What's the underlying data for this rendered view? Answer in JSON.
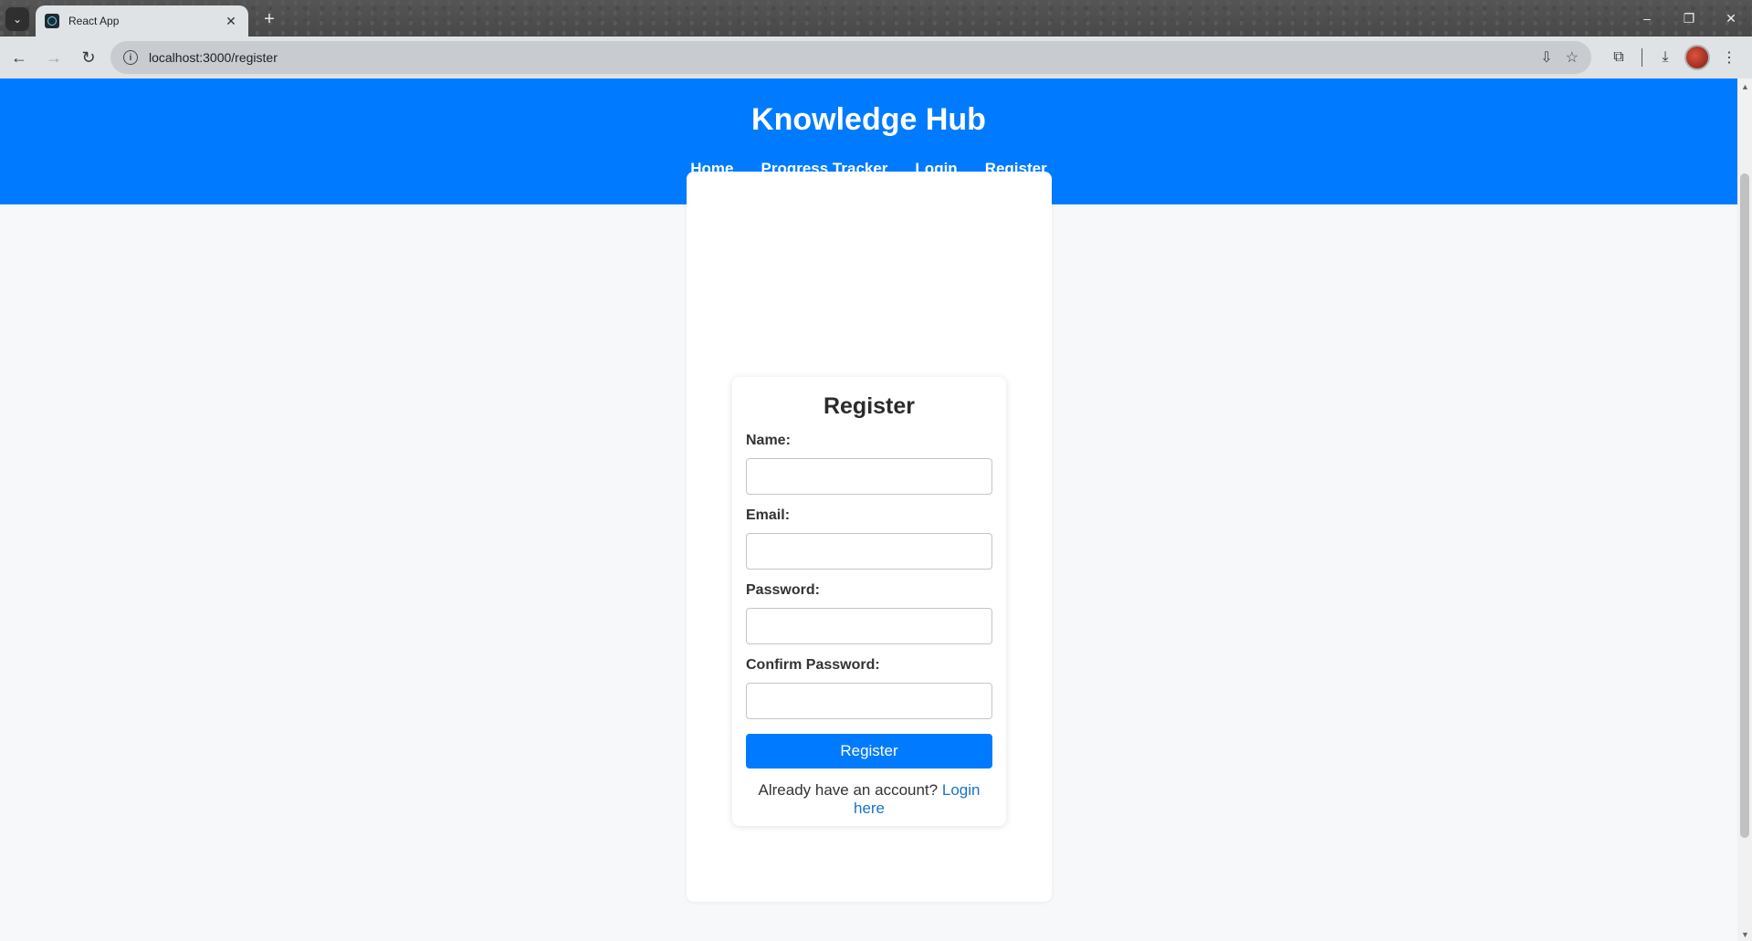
{
  "browser": {
    "tab_title": "React App",
    "url": "localhost:3000/register"
  },
  "site": {
    "title": "Knowledge Hub",
    "nav": [
      "Home",
      "Progress Tracker",
      "Login",
      "Register"
    ]
  },
  "form": {
    "title": "Register",
    "fields": {
      "name_label": "Name:",
      "email_label": "Email:",
      "password_label": "Password:",
      "confirm_label": "Confirm Password:"
    },
    "submit_label": "Register",
    "prompt_text": "Already have an account?",
    "login_link": "Login here"
  },
  "colors": {
    "accent": "#007bff",
    "link": "#1a73c8",
    "page_bg": "#f7f8fa"
  }
}
